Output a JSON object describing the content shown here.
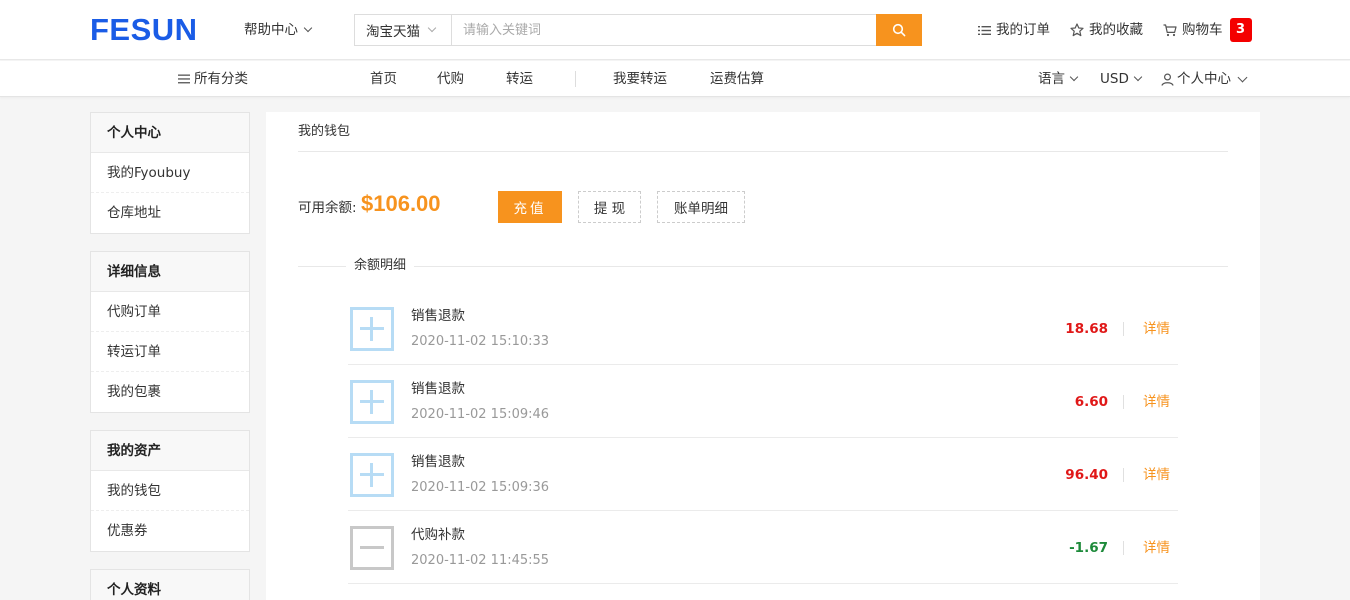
{
  "header": {
    "logo": "FESUN",
    "help_center": "帮助中心",
    "search": {
      "scope": "淘宝天猫",
      "placeholder": "请输入关键词",
      "value": ""
    },
    "links": {
      "orders": "我的订单",
      "favorites": "我的收藏",
      "cart": "购物车",
      "cart_count": "3"
    }
  },
  "nav": {
    "all_categories": "所有分类",
    "items": [
      "首页",
      "代购",
      "转运",
      "我要转运",
      "运费估算"
    ],
    "language": "语言",
    "currency": "USD",
    "user_center": "个人中心"
  },
  "sidebar": {
    "groups": [
      {
        "title": "个人中心",
        "items": [
          "我的Fyoubuy",
          "仓库地址"
        ]
      },
      {
        "title": "详细信息",
        "items": [
          "代购订单",
          "转运订单",
          "我的包裹"
        ]
      },
      {
        "title": "我的资产",
        "items": [
          "我的钱包",
          "优惠券"
        ]
      },
      {
        "title": "个人资料",
        "items": []
      }
    ]
  },
  "wallet": {
    "title": "我的钱包",
    "balance_label": "可用余额:",
    "balance_value": "$106.00",
    "recharge": "充值",
    "withdraw": "提 现",
    "bill_detail": "账单明细",
    "section_title": "余额明细",
    "transactions": [
      {
        "type": "plus",
        "name": "销售退款",
        "time": "2020-11-02 15:10:33",
        "amount": "18.68",
        "detail": "详情"
      },
      {
        "type": "plus",
        "name": "销售退款",
        "time": "2020-11-02 15:09:46",
        "amount": "6.60",
        "detail": "详情"
      },
      {
        "type": "plus",
        "name": "销售退款",
        "time": "2020-11-02 15:09:36",
        "amount": "96.40",
        "detail": "详情"
      },
      {
        "type": "minus",
        "name": "代购补款",
        "time": "2020-11-02 11:45:55",
        "amount": "-1.67",
        "detail": "详情"
      }
    ]
  },
  "colors": {
    "brand": "#1a5ce6",
    "accent": "#f7931e",
    "positive": "#e01818",
    "negative": "#1d8a3a",
    "badge": "#f40000"
  }
}
